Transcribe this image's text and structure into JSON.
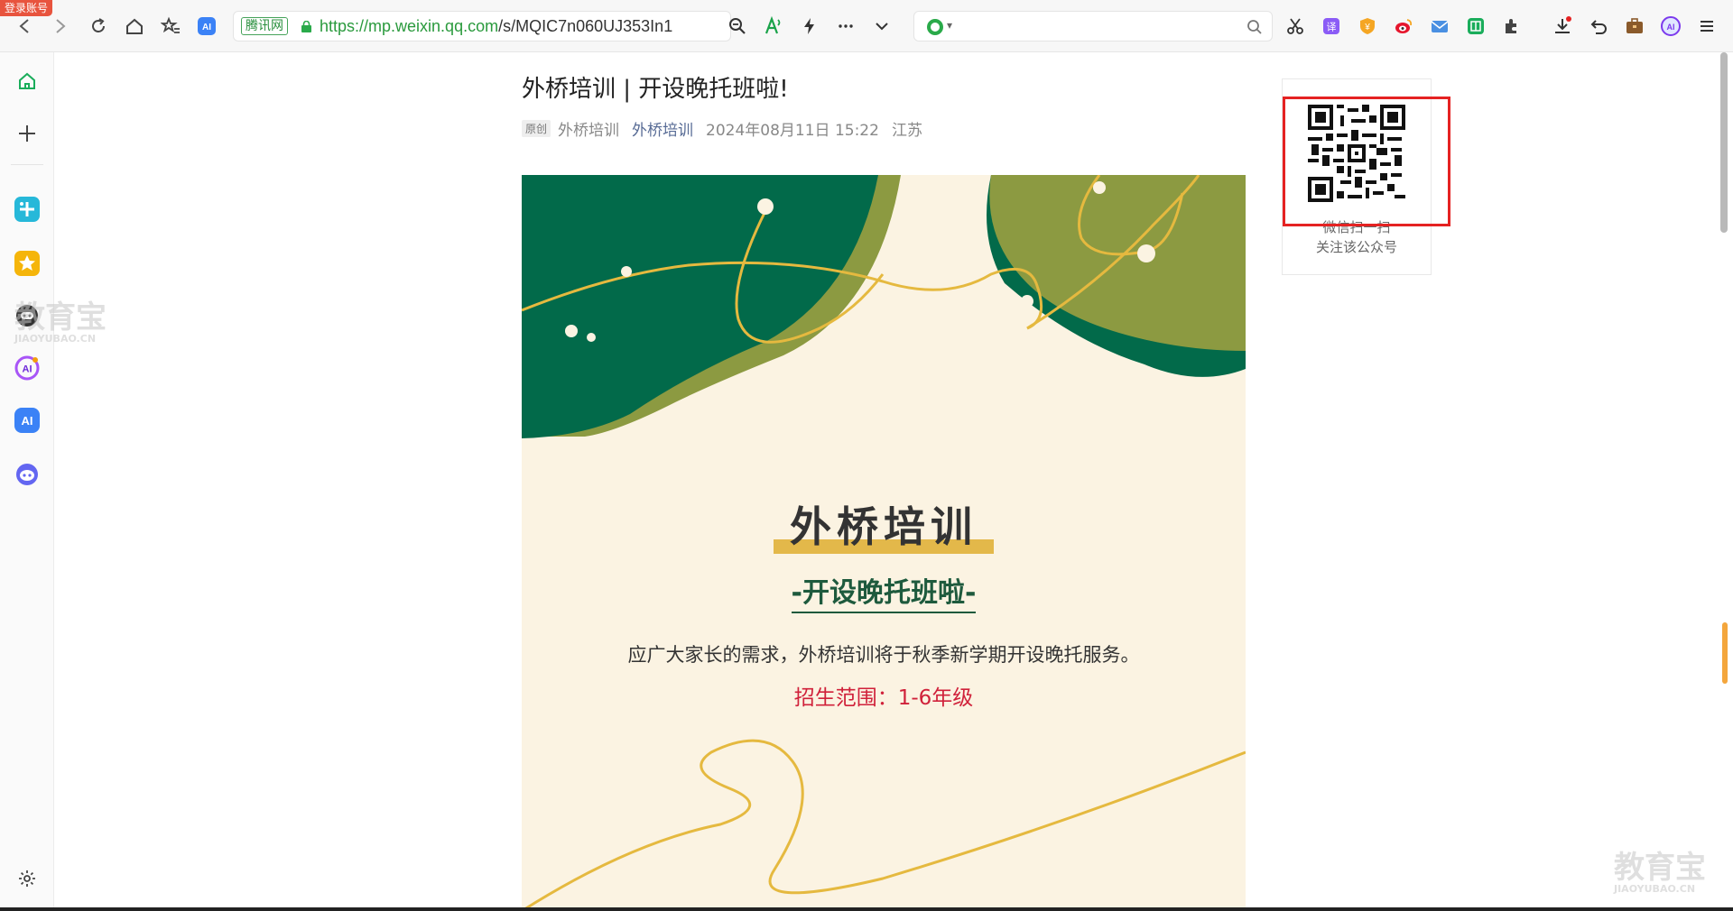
{
  "browser": {
    "login_badge": "登录账号",
    "cert_label": "腾讯网",
    "url_host": "https://mp.weixin.qq.com",
    "url_path": "/s/MQIC7n060UJ353In1",
    "search_placeholder": ""
  },
  "article": {
    "title": "外桥培训 | 开设晚托班啦!",
    "original_tag": "原创",
    "author": "外桥培训",
    "account": "外桥培训",
    "date": "2024年08月11日 15:22",
    "location": "江苏"
  },
  "poster": {
    "heading": "外桥培训",
    "subheading": "-开设晚托班啦-",
    "body": "应广大家长的需求，外桥培训将于秋季新学期开设晚托服务。",
    "enroll": "招生范围：1-6年级",
    "colors": {
      "dark_green": "#026a4a",
      "olive": "#8c9a41",
      "gold": "#e5b93f",
      "cream": "#fbf3e2"
    }
  },
  "qr": {
    "caption1": "微信扫一扫",
    "caption2": "关注该公众号"
  },
  "watermark": {
    "logo": "教育宝",
    "logo_sub": "JIAOYUBAO.CN"
  }
}
